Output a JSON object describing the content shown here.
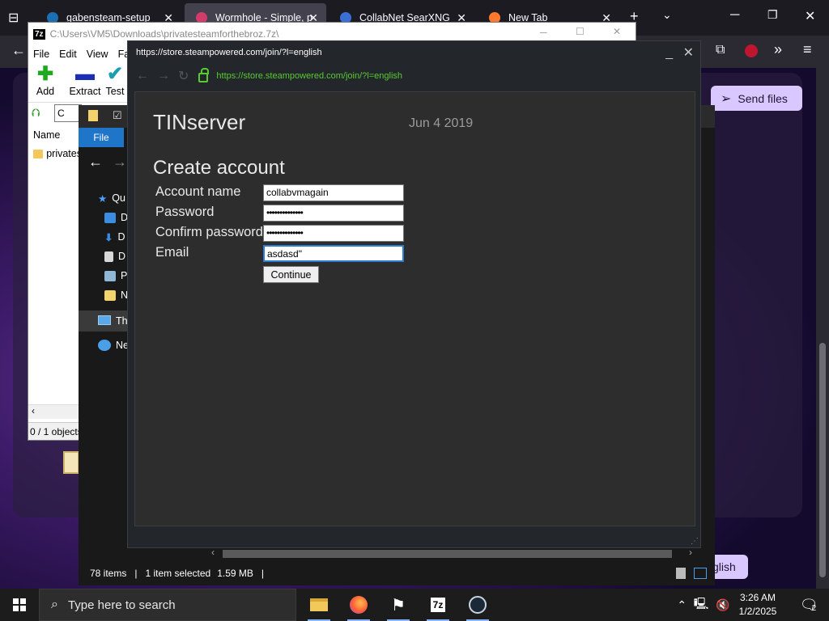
{
  "browser": {
    "tabs": [
      {
        "label": "gabensteam-setup",
        "favicon": "steam-favicon"
      },
      {
        "label": "Wormhole - Simple, pr",
        "favicon": "wormhole-favicon"
      },
      {
        "label": "CollabNet SearXNG",
        "favicon": "searxng-favicon"
      },
      {
        "label": "New Tab",
        "favicon": "firefox-favicon"
      }
    ],
    "send_files_label": "Send files",
    "language_chip": "glish"
  },
  "zip": {
    "title": "C:\\Users\\VM5\\Downloads\\privatesteamforthebroz.7z\\",
    "menu": [
      "File",
      "Edit",
      "View",
      "Fa"
    ],
    "tools": [
      "Add",
      "Extract",
      "Test"
    ],
    "column_name": "Name",
    "row_name": "privates",
    "status": "0 / 1 objects",
    "addr_label": "C"
  },
  "explorer": {
    "file_tab": "File",
    "sidebar": [
      {
        "label": "Qu",
        "icon": "star-icon"
      },
      {
        "label": "D",
        "icon": "desktop-icon"
      },
      {
        "label": "D",
        "icon": "download-icon"
      },
      {
        "label": "D",
        "icon": "document-icon"
      },
      {
        "label": "P",
        "icon": "pictures-icon"
      },
      {
        "label": "N",
        "icon": "folder-icon"
      },
      {
        "label": "Th",
        "icon": "this-pc-icon"
      },
      {
        "label": "Ne",
        "icon": "network-icon"
      }
    ],
    "status": {
      "items": "78 items",
      "selected": "1 item selected",
      "size": "1.59 MB"
    }
  },
  "steam": {
    "title": "https://store.steampowered.com/join/?l=english",
    "url": "https://store.steampowered.com/join/?l=english",
    "brand": "TINserver",
    "build_date": "Jun 4 2019",
    "heading": "Create account",
    "fields": {
      "account_name": {
        "label": "Account name",
        "value": "collabvmagain"
      },
      "password": {
        "label": "Password",
        "value": "••••••••••••••"
      },
      "confirm_password": {
        "label": "Confirm password",
        "value": "••••••••••••••"
      },
      "email": {
        "label": "Email",
        "value": "asdasd\""
      }
    },
    "continue_label": "Continue"
  },
  "taskbar": {
    "search_placeholder": "Type here to search",
    "time": "3:26 AM",
    "date": "1/2/2025",
    "notification_count": "2"
  },
  "colors": {
    "steam_green": "#57cb2f",
    "accent_blue": "#1f76c9",
    "send_files_bg": "#d9c8ff"
  }
}
